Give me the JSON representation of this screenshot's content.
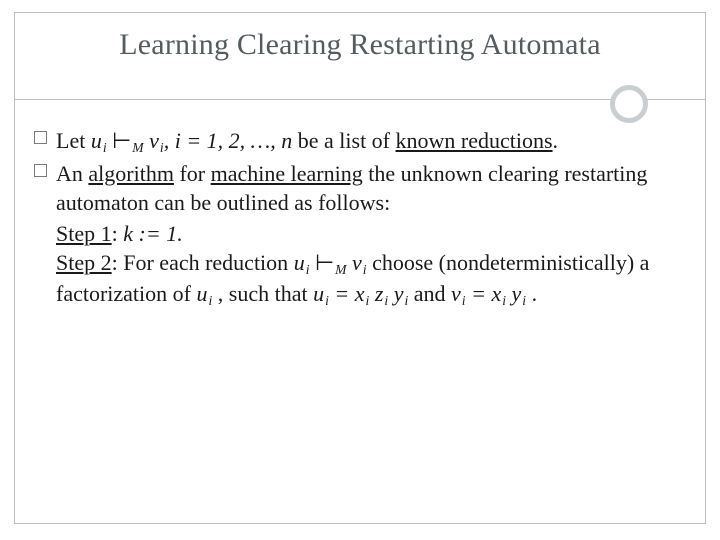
{
  "title": "Learning Clearing Restarting Automata",
  "b1": {
    "let": "Let ",
    "u": "u",
    "i1": "i",
    "turn": " ⊢",
    "M": "M",
    "sp": " ",
    "v": "v",
    "i2": "i",
    "range": ", i = 1, 2, …, n",
    "be": " be a list of ",
    "known": "known reductions",
    "dot": "."
  },
  "b2": {
    "an": "An ",
    "alg": "algorithm",
    "for": " for ",
    "ml": "machine learning",
    "rest": " the unknown clearing restarting automaton can be outlined as follows:"
  },
  "s1": {
    "label": "Step 1",
    "colon": ": ",
    "k": "k",
    "assign": " := 1."
  },
  "s2": {
    "label": "Step 2",
    "colon": ": For each reduction ",
    "u": "u",
    "i1": "i",
    "turn": " ⊢",
    "M": "M",
    "sp": " ",
    "v": "v",
    "i2": "i",
    "choose": " choose (nondeterministically) a factorization of ",
    "u2": "u",
    "i3": "i",
    "such": " , such that ",
    "u3": "u",
    "i4": "i",
    "eq1": " = ",
    "x1": "x",
    "i5": "i",
    "z": " z",
    "i6": "i",
    "y1": " y",
    "i7": "i",
    "and": " and ",
    "v2": "v",
    "i8": "i",
    "eq2": " = ",
    "x2": "x",
    "i9": "i",
    "y2": " y",
    "i10": "i",
    "end": " ."
  }
}
